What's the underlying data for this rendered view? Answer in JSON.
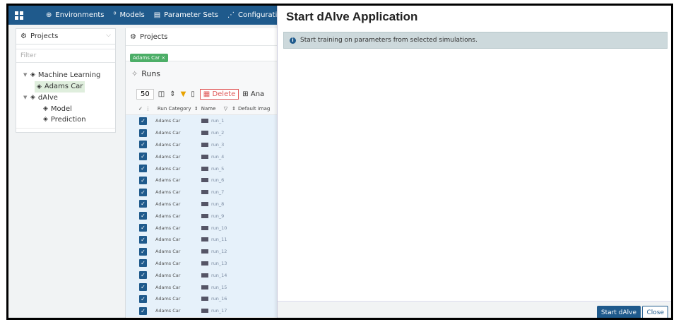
{
  "nav": {
    "items": [
      {
        "icon": "globe-icon",
        "glyph": "⊕",
        "label": "Environments"
      },
      {
        "icon": "models-icon",
        "glyph": "⁰",
        "label": "Models"
      },
      {
        "icon": "document-icon",
        "glyph": "▤",
        "label": "Parameter Sets"
      },
      {
        "icon": "network-icon",
        "glyph": "⋰",
        "label": "Configurations"
      }
    ]
  },
  "left": {
    "selector_label": "Projects",
    "filter_placeholder": "Filter",
    "tree": [
      {
        "label": "Machine Learning",
        "level": 0,
        "toggle": "▼"
      },
      {
        "label": "Adams Car",
        "level": 1,
        "selected": true
      },
      {
        "label": "dAlve",
        "level": 0,
        "toggle": "▼"
      },
      {
        "label": "Model",
        "level": 2
      },
      {
        "label": "Prediction",
        "level": 2
      }
    ]
  },
  "middle": {
    "title": "Projects",
    "chip": "Adams Car ×",
    "runs_title": "Runs",
    "page_size": "50",
    "delete_label": "Delete",
    "ana_label": "Ana",
    "columns": [
      "Run Category",
      "Name",
      "Default imag"
    ],
    "rows": [
      {
        "category": "Adams Car",
        "name": "run_1"
      },
      {
        "category": "Adams Car",
        "name": "run_2"
      },
      {
        "category": "Adams Car",
        "name": "run_3"
      },
      {
        "category": "Adams Car",
        "name": "run_4"
      },
      {
        "category": "Adams Car",
        "name": "run_5"
      },
      {
        "category": "Adams Car",
        "name": "run_6"
      },
      {
        "category": "Adams Car",
        "name": "run_7"
      },
      {
        "category": "Adams Car",
        "name": "run_8"
      },
      {
        "category": "Adams Car",
        "name": "run_9"
      },
      {
        "category": "Adams Car",
        "name": "run_10"
      },
      {
        "category": "Adams Car",
        "name": "run_11"
      },
      {
        "category": "Adams Car",
        "name": "run_12"
      },
      {
        "category": "Adams Car",
        "name": "run_13"
      },
      {
        "category": "Adams Car",
        "name": "run_14"
      },
      {
        "category": "Adams Car",
        "name": "run_15"
      },
      {
        "category": "Adams Car",
        "name": "run_16"
      },
      {
        "category": "Adams Car",
        "name": "run_17"
      }
    ]
  },
  "dialog": {
    "title": "Start dAlve Application",
    "info": "Start training on parameters from selected simulations.",
    "start_label": "Start dAlve",
    "close_label": "Close"
  },
  "colors": {
    "primary": "#1f5a8c",
    "selected_bg": "#dfeedd",
    "chip": "#4cae67",
    "delete": "#e05a5a"
  }
}
